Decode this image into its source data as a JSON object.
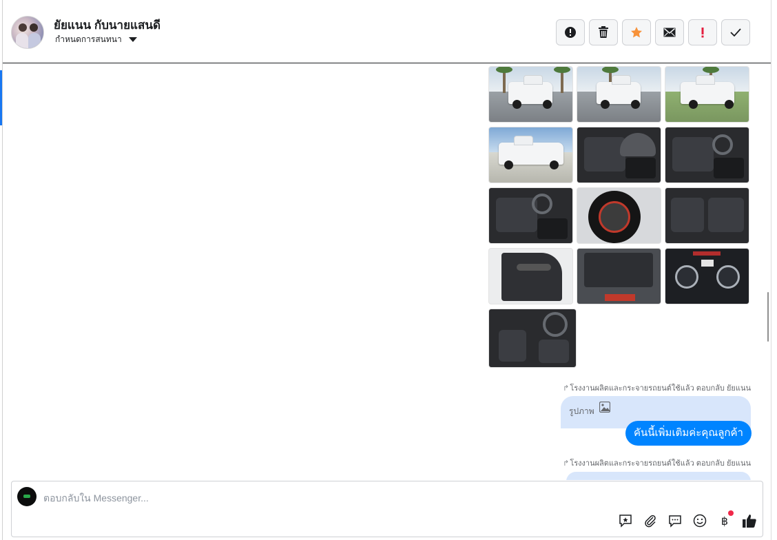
{
  "header": {
    "contact_name": "ยัยแนน กับนายแสนดี",
    "conversation_settings_label": "กำหนดการสนทนา",
    "actions": [
      {
        "name": "spam-button",
        "icon": "alert-circle-icon"
      },
      {
        "name": "delete-button",
        "icon": "trash-icon"
      },
      {
        "name": "star-button",
        "icon": "star-icon"
      },
      {
        "name": "mark-unread-button",
        "icon": "envelope-icon"
      },
      {
        "name": "follow-up-button",
        "icon": "exclamation-icon"
      },
      {
        "name": "done-button",
        "icon": "checkmark-icon"
      }
    ]
  },
  "thread": {
    "photos_count": 13,
    "reply_meta_1": "โรงงานผลิตและกระจายรถยนต์ใช้แล้ว ตอบกลับ ยัยแนน",
    "quoted_label": "รูปภาพ",
    "bubble_text": "คันนี้เพิ่มเติมค่ะคุณลูกค้า",
    "reply_meta_2": "โรงงานผลิตและกระจายรถยนต์ใช้แล้ว ตอบกลับ ยัยแนน"
  },
  "composer": {
    "placeholder": "ตอบกลับใน Messenger...",
    "tools": [
      "saved-reply-icon",
      "attachment-icon",
      "comment-icon",
      "emoji-icon",
      "baht-payment-icon",
      "like-icon"
    ],
    "baht_symbol": "฿"
  },
  "colors": {
    "accent": "#0084ff",
    "star": "#f7923a",
    "alert": "#e41e3f",
    "quoted_bg": "#d8e6fb"
  }
}
